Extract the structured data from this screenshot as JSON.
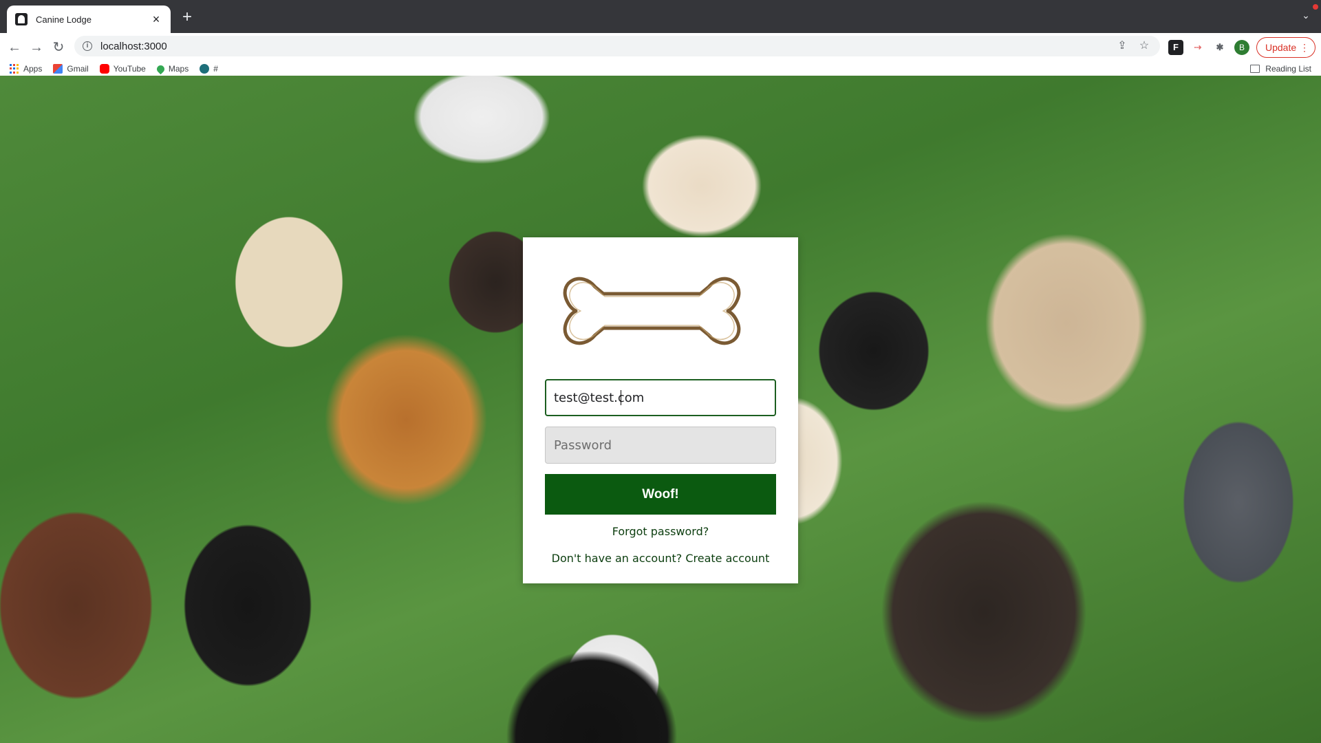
{
  "browser": {
    "tab_title": "Canine Lodge",
    "tab_close": "×",
    "new_tab": "+",
    "tab_search": "⌄",
    "url": "localhost:3000",
    "profile_initial": "B",
    "update_label": "Update",
    "update_menu": "⋮",
    "icons": {
      "back": "←",
      "forward": "→",
      "reload": "↻",
      "info": "i",
      "share": "⇪",
      "star": "☆",
      "ext1": "F",
      "ext2": "⇢",
      "puzzle": "✱"
    }
  },
  "bookmarks": {
    "items": [
      {
        "label": "Apps"
      },
      {
        "label": "Gmail"
      },
      {
        "label": "YouTube"
      },
      {
        "label": "Maps"
      },
      {
        "label": "#"
      }
    ],
    "reading_list": "Reading List"
  },
  "login": {
    "email_value": "test@test.com",
    "password_placeholder": "Password",
    "submit_label": "Woof!",
    "forgot_label": "Forgot password?",
    "signup_label": "Don't have an account? Create account"
  },
  "colors": {
    "brand_green": "#0b5a10",
    "focus_border": "#1b5e20",
    "bone_outline": "#7a5a33"
  }
}
